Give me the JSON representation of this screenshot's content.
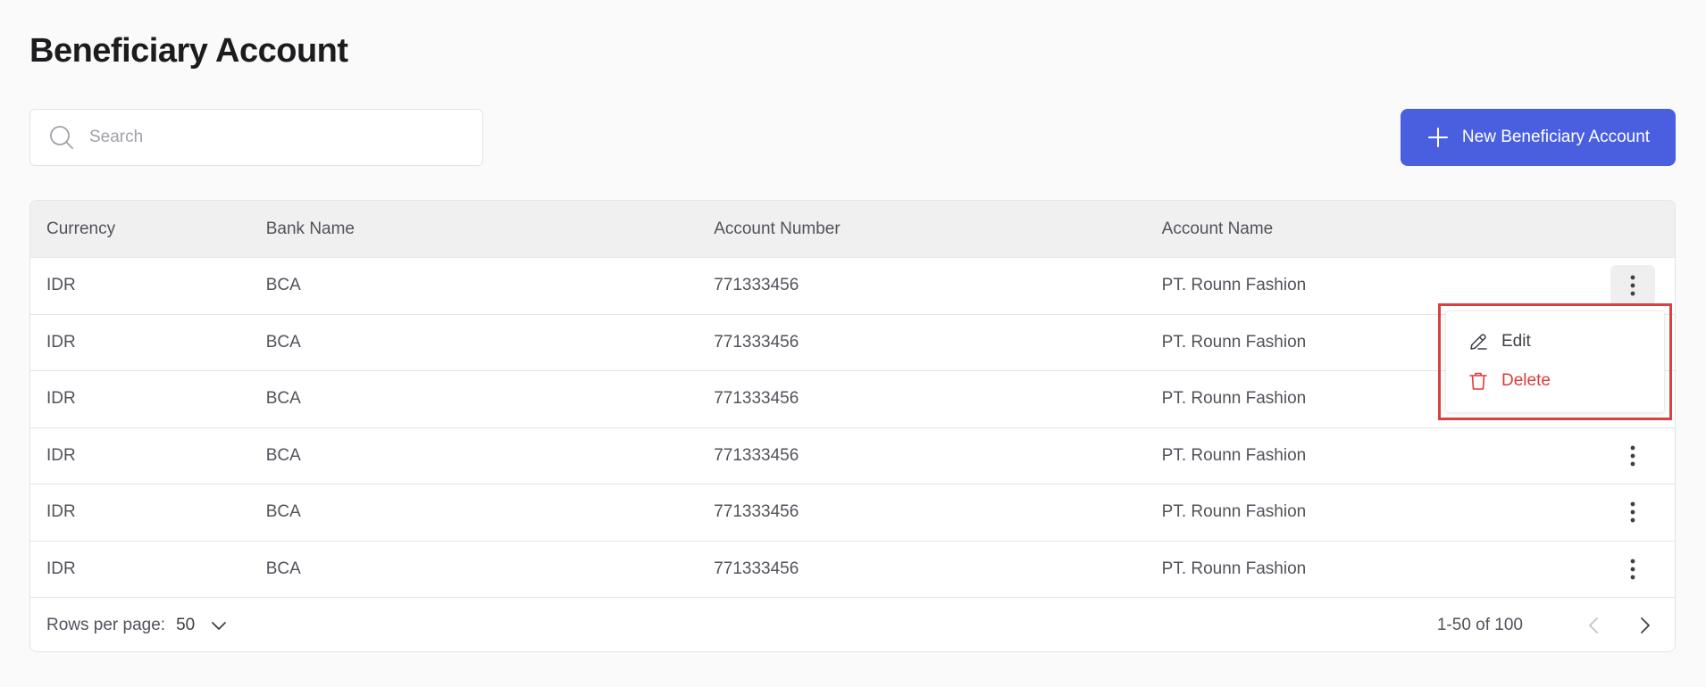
{
  "page": {
    "title": "Beneficiary Account"
  },
  "search": {
    "placeholder": "Search",
    "value": ""
  },
  "toolbar": {
    "new_label": "New Beneficiary Account"
  },
  "table": {
    "columns": [
      "Currency",
      "Bank Name",
      "Account Number",
      "Account Name"
    ],
    "rows": [
      [
        "IDR",
        "BCA",
        "771333456",
        "PT. Rounn Fashion"
      ],
      [
        "IDR",
        "BCA",
        "771333456",
        "PT. Rounn Fashion"
      ],
      [
        "IDR",
        "BCA",
        "771333456",
        "PT. Rounn Fashion"
      ],
      [
        "IDR",
        "BCA",
        "771333456",
        "PT. Rounn Fashion"
      ],
      [
        "IDR",
        "BCA",
        "771333456",
        "PT. Rounn Fashion"
      ],
      [
        "IDR",
        "BCA",
        "771333456",
        "PT. Rounn Fashion"
      ]
    ]
  },
  "footer": {
    "rows_per_page_label": "Rows per page:",
    "rows_per_page_value": "50",
    "range": "1-50 of 100"
  },
  "context_menu": {
    "edit_label": "Edit",
    "delete_label": "Delete"
  },
  "colors": {
    "accent": "#4a5fe0",
    "danger": "#dc3b3b",
    "highlight": "#d9403f"
  },
  "icons": {
    "search": "search-icon",
    "add": "plus-icon",
    "actions": "more-vertical-icon",
    "edit": "pencil-icon",
    "delete": "trash-icon",
    "dropdown": "chevron-down-icon",
    "prev": "chevron-left-icon",
    "next": "chevron-right-icon"
  }
}
